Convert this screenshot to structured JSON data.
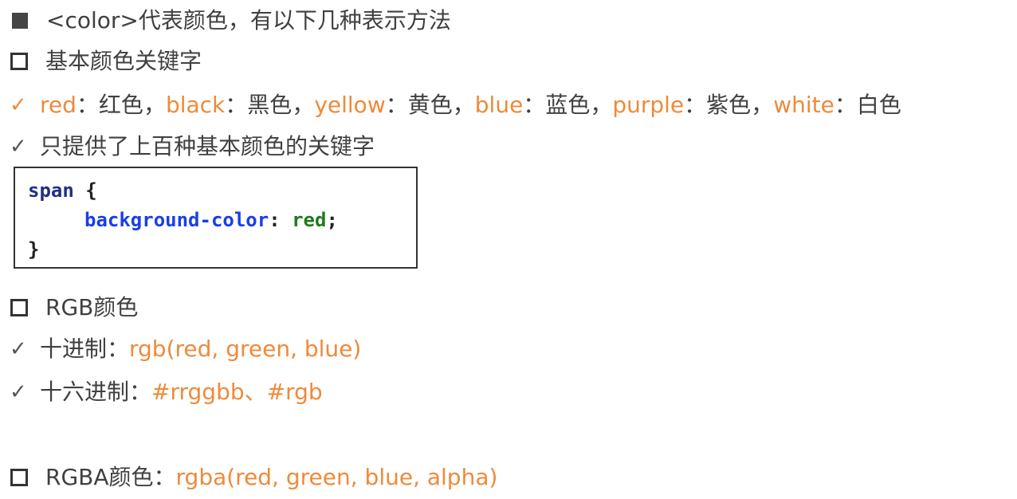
{
  "lines": {
    "l1": {
      "prefix": "<color>",
      "text": "代表颜色，有以下几种表示方法"
    },
    "l2": {
      "text": "基本颜色关键字"
    },
    "l3": {
      "items": [
        {
          "keyword": "red",
          "sep": "：",
          "meaning": "红色",
          "comma": "，"
        },
        {
          "keyword": "black",
          "sep": "：",
          "meaning": "黑色",
          "comma": "，"
        },
        {
          "keyword": "yellow",
          "sep": "：",
          "meaning": "黄色",
          "comma": "，"
        },
        {
          "keyword": "blue",
          "sep": "：",
          "meaning": "蓝色",
          "comma": "，"
        },
        {
          "keyword": "purple",
          "sep": "：",
          "meaning": "紫色",
          "comma": "，"
        },
        {
          "keyword": "white",
          "sep": "：",
          "meaning": "白色",
          "comma": ""
        }
      ]
    },
    "l4": {
      "text": "只提供了上百种基本颜色的关键字"
    },
    "l5": {
      "text": "RGB颜色"
    },
    "l6": {
      "label": "十进制：",
      "value": "rgb(red, green, blue)"
    },
    "l7": {
      "label": "十六进制：",
      "value": "#rrggbb、#rgb"
    },
    "l8": {
      "label": "RGBA颜色：",
      "value": "rgba(red, green, blue, alpha)"
    }
  },
  "code": {
    "selector": "span",
    "open_brace": " {",
    "property": "background-color",
    "colon": ":",
    "value": "red",
    "semicolon": ";",
    "close_brace": "}"
  },
  "colors": {
    "accent_orange": "#ef8a3a",
    "text_gray": "#404040",
    "code_selector": "#1f2f86",
    "code_property": "#1a3ee8",
    "code_value": "#1f7a1f"
  }
}
